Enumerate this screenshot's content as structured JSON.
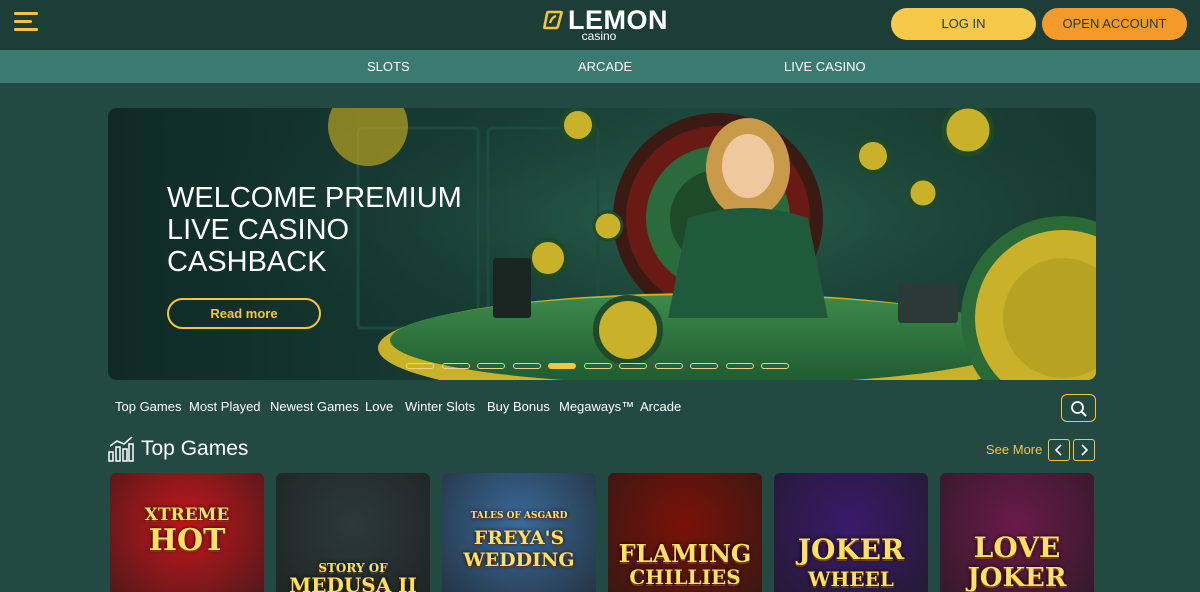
{
  "header": {
    "logo_text": "LEMON",
    "logo_sub": "casino",
    "login_label": "LOG IN",
    "open_account_label": "OPEN ACCOUNT"
  },
  "nav": {
    "items": [
      "SLOTS",
      "ARCADE",
      "LIVE CASINO"
    ]
  },
  "banner": {
    "title_lines": [
      "WELCOME PREMIUM",
      "LIVE CASINO",
      "CASHBACK"
    ],
    "read_more_label": "Read more",
    "slide_count": 11,
    "active_slide": 5
  },
  "categories": [
    "Top Games",
    "Most Played",
    "Newest Games",
    "Love",
    "Winter Slots",
    "Buy Bonus",
    "Megaways™",
    "Arcade"
  ],
  "top_games": {
    "title": "Top Games",
    "see_more_label": "See More",
    "games": [
      {
        "name": "XTREME HOT",
        "line1": "XTREME",
        "line2": "HOT",
        "bg": "#c4161c"
      },
      {
        "name": "STORY OF MEDUSA II",
        "line1": "STORY OF",
        "line2": "MEDUSA II",
        "bg": "#2c3a3a"
      },
      {
        "name": "FREYA'S WEDDING",
        "line1": "TALES OF ASGARD",
        "line2": "FREYA'S WEDDING",
        "bg": "#3a6a9a"
      },
      {
        "name": "FLAMING CHILLIES",
        "line1": "FLAMING",
        "line2": "CHILLIES",
        "bg": "#7a1208"
      },
      {
        "name": "JOKER WHEEL",
        "line1": "JOKER",
        "line2": "WHEEL",
        "bg": "#3a1a6a"
      },
      {
        "name": "LOVE JOKER",
        "line1": "LOVE",
        "line2": "JOKER",
        "bg": "#6a1a4a"
      }
    ]
  },
  "colors": {
    "accent": "#f5c542",
    "accent_orange": "#f39a2b",
    "header_bg": "#1d3d37",
    "nav_bg": "#3a7a70",
    "page_bg": "#234a42"
  }
}
